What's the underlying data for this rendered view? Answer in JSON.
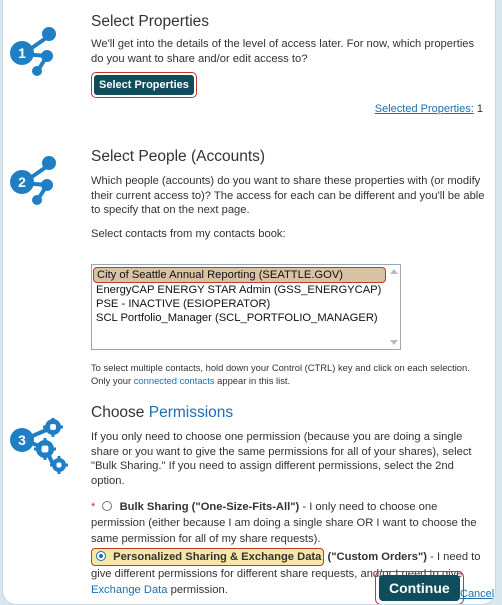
{
  "step1": {
    "number": "1",
    "title": "Select Properties",
    "description": "We'll get into the details of the level of access later. For now, which properties do you want to share and/or edit access to?",
    "button_label": "Select Properties",
    "selected_label": "Selected Properties:",
    "selected_count": "1"
  },
  "step2": {
    "number": "2",
    "title": "Select People (Accounts)",
    "description": "Which people (accounts) do you want to share these properties with (or modify their current access to)? The access for each can be different and you'll be able to specify that on the next page.",
    "contacts_label": "Select contacts from my contacts book:",
    "contacts": [
      "City of Seattle Annual Reporting (SEATTLE.GOV)",
      "EnergyCAP ENERGY STAR Admin (GSS_ENERGYCAP)",
      "PSE - INACTIVE (ESIOPERATOR)",
      "SCL Portfolio_Manager (SCL_PORTFOLIO_MANAGER)"
    ],
    "note_before_link": "To select multiple contacts, hold down your Control (CTRL) key and click on each selection. Only your",
    "note_link": "connected contacts",
    "note_after_link": "appear in this list."
  },
  "step3": {
    "number": "3",
    "title_prefix": "Choose",
    "title_accent": "Permissions",
    "description": "If you only need to choose one permission (because you are doing a single share or you want to give the same permissions for all of your shares), select \"Bulk Sharing.\" If you need to assign different permissions, select the 2nd option.",
    "required_mark": "*",
    "option1_bold": "Bulk Sharing (\"One-Size-Fits-All\")",
    "option1_text": "- I only need to choose one permission (either because I am doing a single share OR I want to choose the same permission for all of my share requests).",
    "option2_bold_highlight": "Personalized Sharing & Exchange Data",
    "option2_bold_rest": "(\"Custom Orders\")",
    "option2_text": "- I need to give different permissions for different share requests, and/or I need to give",
    "option2_link": "Exchange Data",
    "option2_tail": "permission.",
    "continue_label": "Continue",
    "cancel_label": "Cancel"
  },
  "colors": {
    "accent": "#1a6fb0",
    "icon_blue": "#1f7fc4",
    "button_bg": "#0f4c5c",
    "highlight_border": "#c0392b",
    "selected_row": "#d8c3a5",
    "highlight_fill": "#f6e7a8"
  },
  "icons": [
    "share-network-icon",
    "gear-network-icon"
  ]
}
